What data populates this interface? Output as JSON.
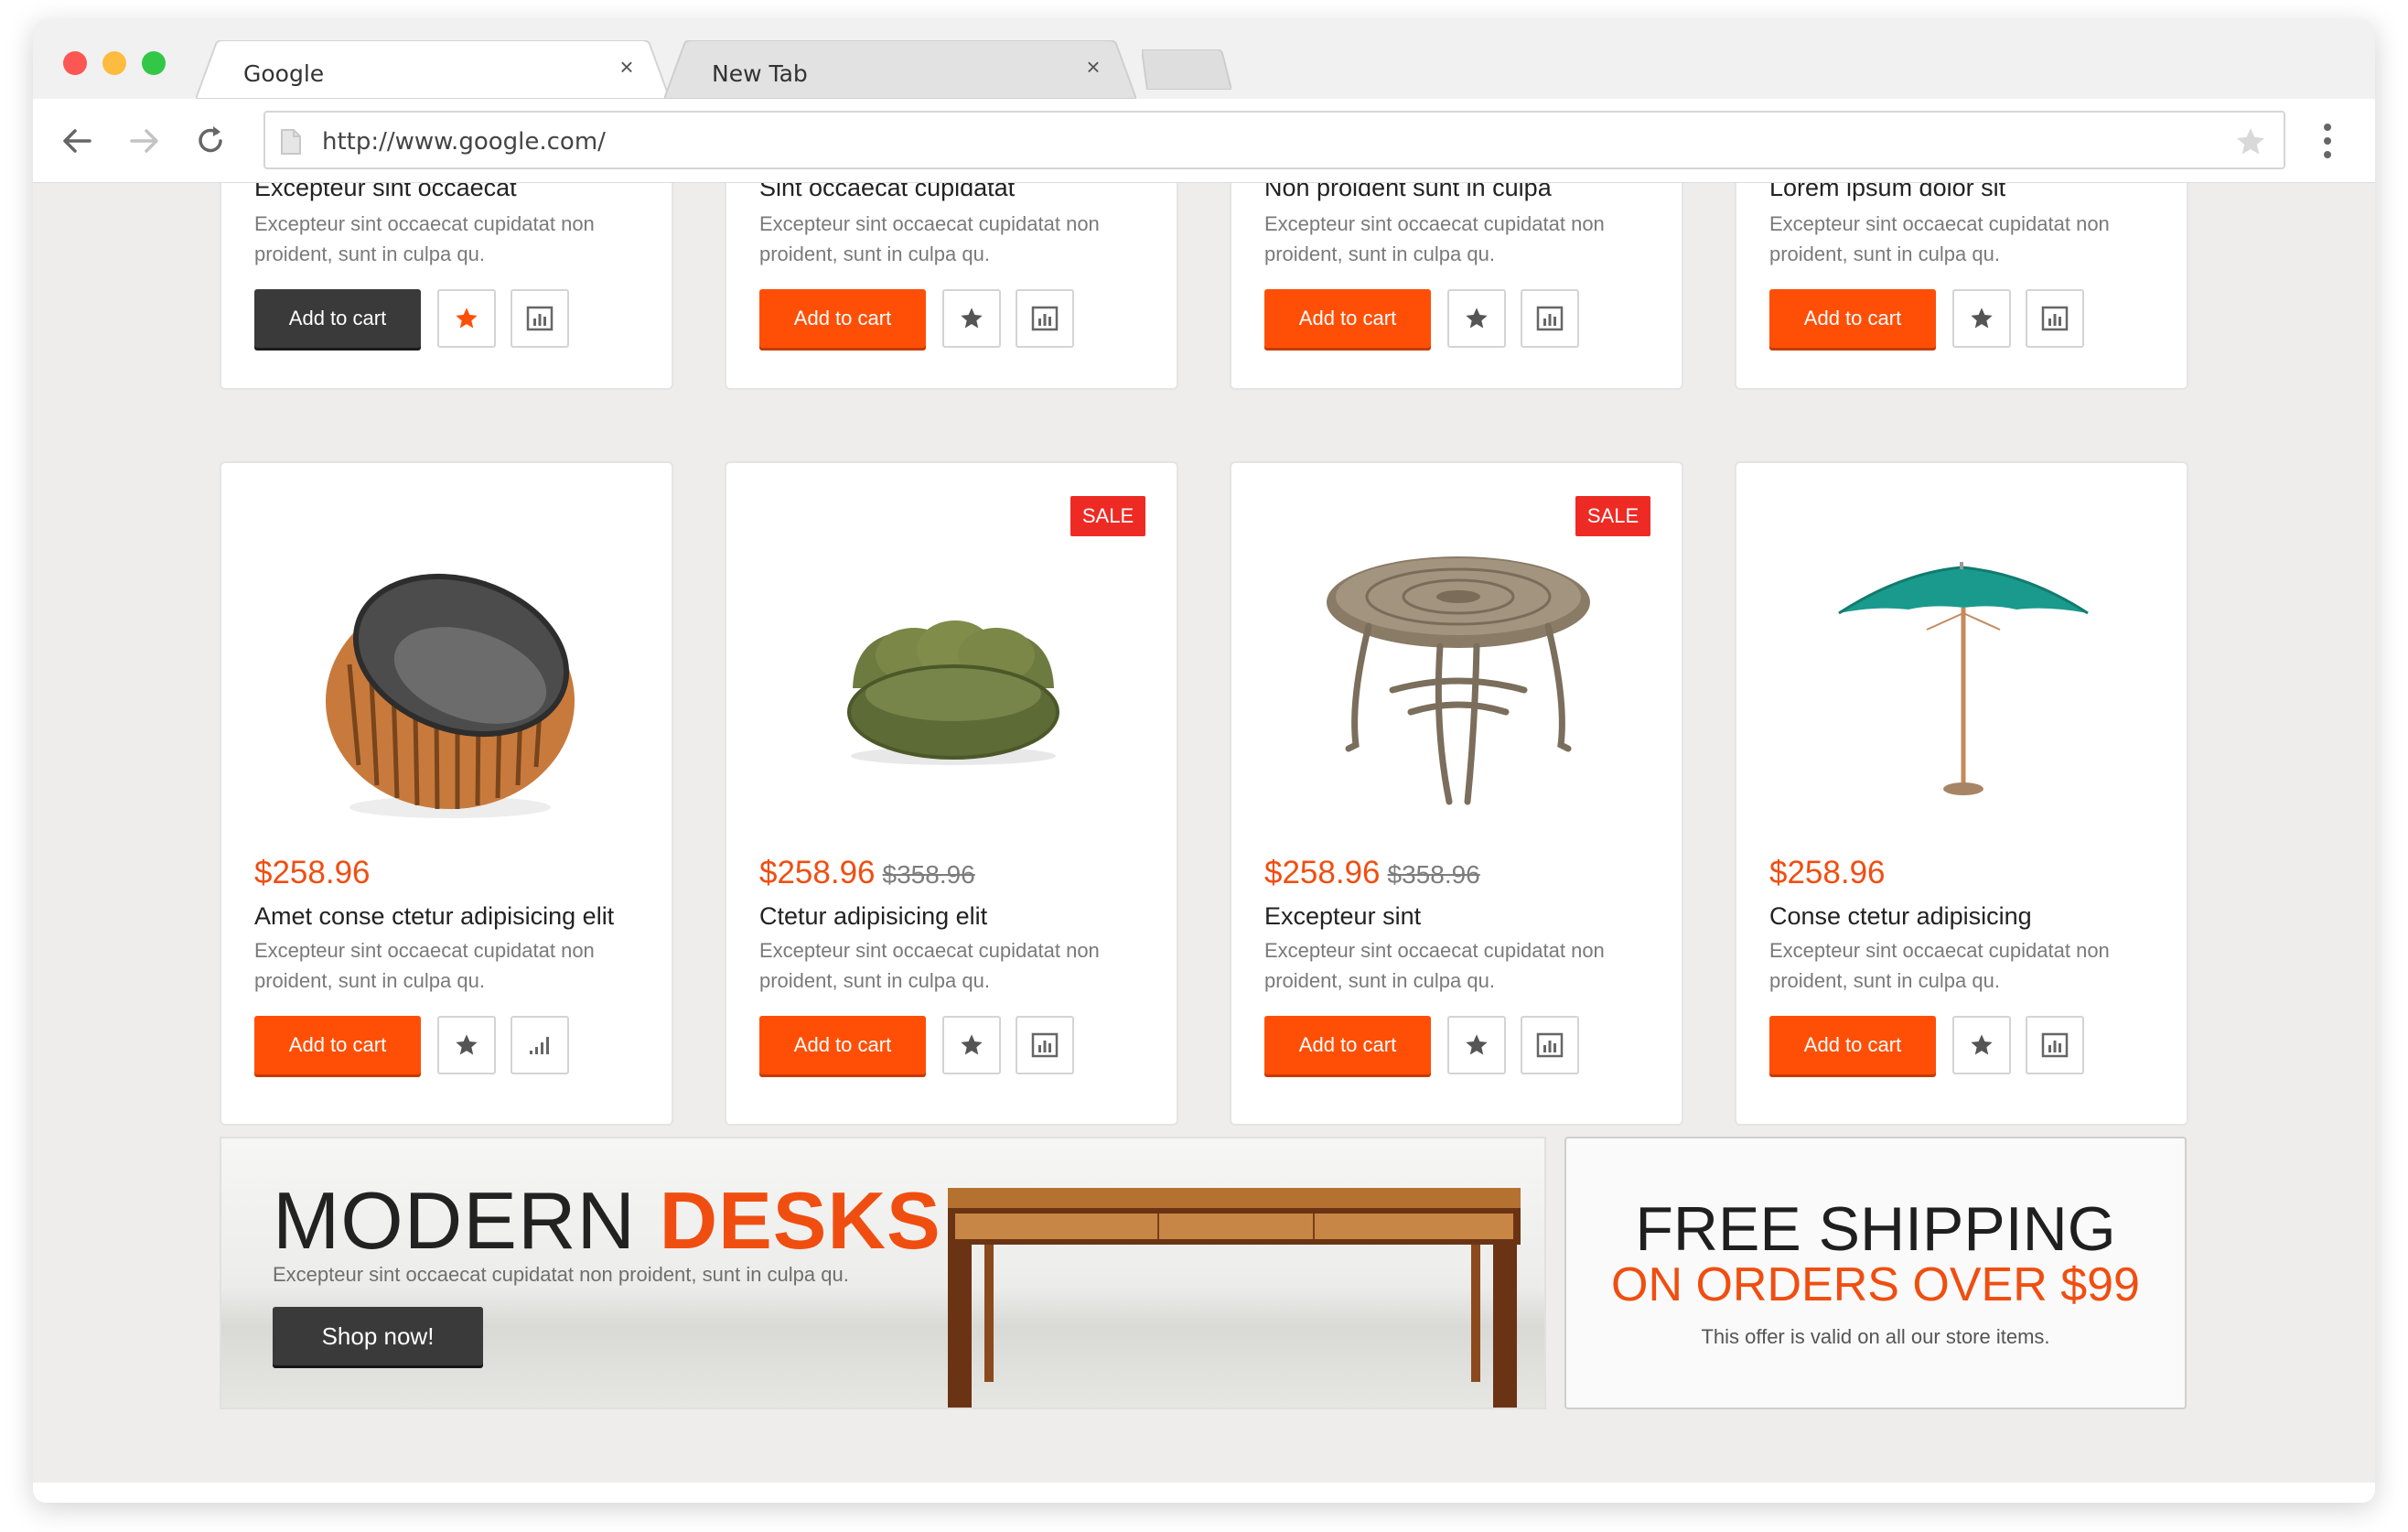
{
  "browser": {
    "tabs": [
      {
        "label": "Google",
        "close": "×"
      },
      {
        "label": "New Tab",
        "close": "×"
      }
    ],
    "url": "http://www.google.com/"
  },
  "top_products": [
    {
      "title": "Excepteur sint occaecat",
      "desc": "Excepteur sint occaecat cupidatat non proident, sunt in culpa qu.",
      "cart": "Add to cart",
      "cart_active": true,
      "wishlist_active": true
    },
    {
      "title": "Sint occaecat cupidatat",
      "desc": "Excepteur sint occaecat cupidatat non proident, sunt in culpa qu.",
      "cart": "Add to cart"
    },
    {
      "title": "Non proident sunt in culpa",
      "desc": "Excepteur sint occaecat cupidatat non proident, sunt in culpa qu.",
      "cart": "Add to cart"
    },
    {
      "title": "Lorem ipsum dolor sit",
      "desc": "Excepteur sint occaecat cupidatat non proident, sunt in culpa qu.",
      "cart": "Add to cart"
    }
  ],
  "products": [
    {
      "image": "round-rattan-chair",
      "price": "$258.96",
      "old_price": "",
      "sale": "",
      "title": "Amet conse ctetur adipisicing elit",
      "desc": "Excepteur sint occaecat cupidatat non proident, sunt in culpa qu.",
      "cart": "Add to cart"
    },
    {
      "image": "green-loveseat",
      "price": "$258.96",
      "old_price": "$358.96",
      "sale": "SALE",
      "title": "Ctetur adipisicing elit",
      "desc": "Excepteur sint occaecat cupidatat non proident, sunt in culpa qu.",
      "cart": "Add to cart"
    },
    {
      "image": "round-patio-table",
      "price": "$258.96",
      "old_price": "$358.96",
      "sale": "SALE",
      "title": "Excepteur sint",
      "desc": "Excepteur sint occaecat cupidatat non proident, sunt in culpa qu.",
      "cart": "Add to cart"
    },
    {
      "image": "patio-umbrella",
      "price": "$258.96",
      "old_price": "",
      "sale": "",
      "title": "Conse ctetur adipisicing",
      "desc": "Excepteur sint occaecat cupidatat non proident, sunt in culpa qu.",
      "cart": "Add to cart"
    }
  ],
  "banner_desks": {
    "heading_light": "MODERN ",
    "heading_accent": "DESKS",
    "subtitle": "Excepteur sint occaecat cupidatat non proident, sunt in culpa qu.",
    "button": "Shop now!"
  },
  "banner_shipping": {
    "line1": "FREE SHIPPING",
    "line2": "ON ORDERS OVER $99",
    "line3": "This offer is valid on all our store items."
  },
  "colors": {
    "accent": "#ff4f07",
    "price": "#f04e11",
    "sale": "#ee2a24",
    "dark_button": "#3a3a3a"
  }
}
